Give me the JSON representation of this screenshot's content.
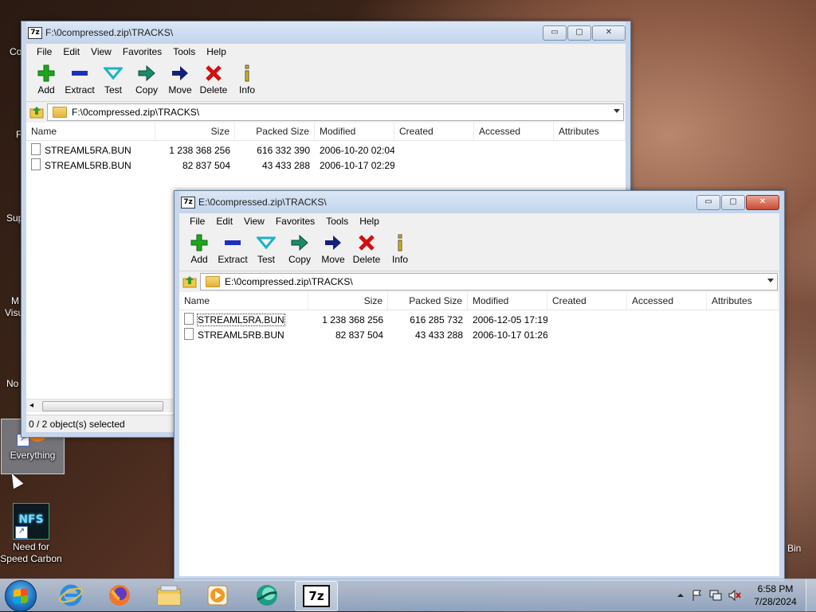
{
  "desktop": {
    "icons": [
      {
        "label": "Everything"
      },
      {
        "label": "Need for Speed Carbon"
      }
    ],
    "edge_labels": [
      "Co",
      "F",
      "Sup",
      "M",
      "Visu",
      "No",
      "Bin"
    ],
    "nfs_logo_text": "NFS"
  },
  "back_window": {
    "title": "F:\\0compressed.zip\\TRACKS\\",
    "address": "F:\\0compressed.zip\\TRACKS\\",
    "status": "0 / 2 object(s) selected",
    "rows": [
      {
        "name": "STREAML5RA.BUN",
        "size": "1 238 368 256",
        "packed": "616 332 390",
        "modified": "2006-10-20 02:04",
        "created": "",
        "accessed": ""
      },
      {
        "name": "STREAML5RB.BUN",
        "size": "82 837 504",
        "packed": "43 433 288",
        "modified": "2006-10-17 02:29",
        "created": "",
        "accessed": ""
      }
    ]
  },
  "front_window": {
    "title": "E:\\0compressed.zip\\TRACKS\\",
    "address": "E:\\0compressed.zip\\TRACKS\\",
    "rows": [
      {
        "name": "STREAML5RA.BUN",
        "size": "1 238 368 256",
        "packed": "616 285 732",
        "modified": "2006-12-05 17:19",
        "created": "",
        "accessed": ""
      },
      {
        "name": "STREAML5RB.BUN",
        "size": "82 837 504",
        "packed": "43 433 288",
        "modified": "2006-10-17 01:26",
        "created": "",
        "accessed": ""
      }
    ]
  },
  "menu": [
    "File",
    "Edit",
    "View",
    "Favorites",
    "Tools",
    "Help"
  ],
  "toolbar": [
    "Add",
    "Extract",
    "Test",
    "Copy",
    "Move",
    "Delete",
    "Info"
  ],
  "columns": [
    "Name",
    "Size",
    "Packed Size",
    "Modified",
    "Created",
    "Accessed",
    "Attributes"
  ],
  "app_icon_text": "7z",
  "window_buttons": {
    "minimize": "▭",
    "maximize": "▢",
    "close": "✕"
  },
  "taskbar": {
    "items": [
      "internet-explorer",
      "firefox",
      "file-explorer",
      "media-player",
      "app-green-globe",
      "7zip"
    ],
    "active_label": "7z",
    "clock_time": "6:58 PM",
    "clock_date": "7/28/2024"
  },
  "colors": {
    "add": "#1ea51e",
    "extract": "#1e2fbf",
    "test": "#1bb3c8",
    "copy": "#1a8c6a",
    "move": "#14207a",
    "delete": "#d01010",
    "info": "#d8b400"
  }
}
